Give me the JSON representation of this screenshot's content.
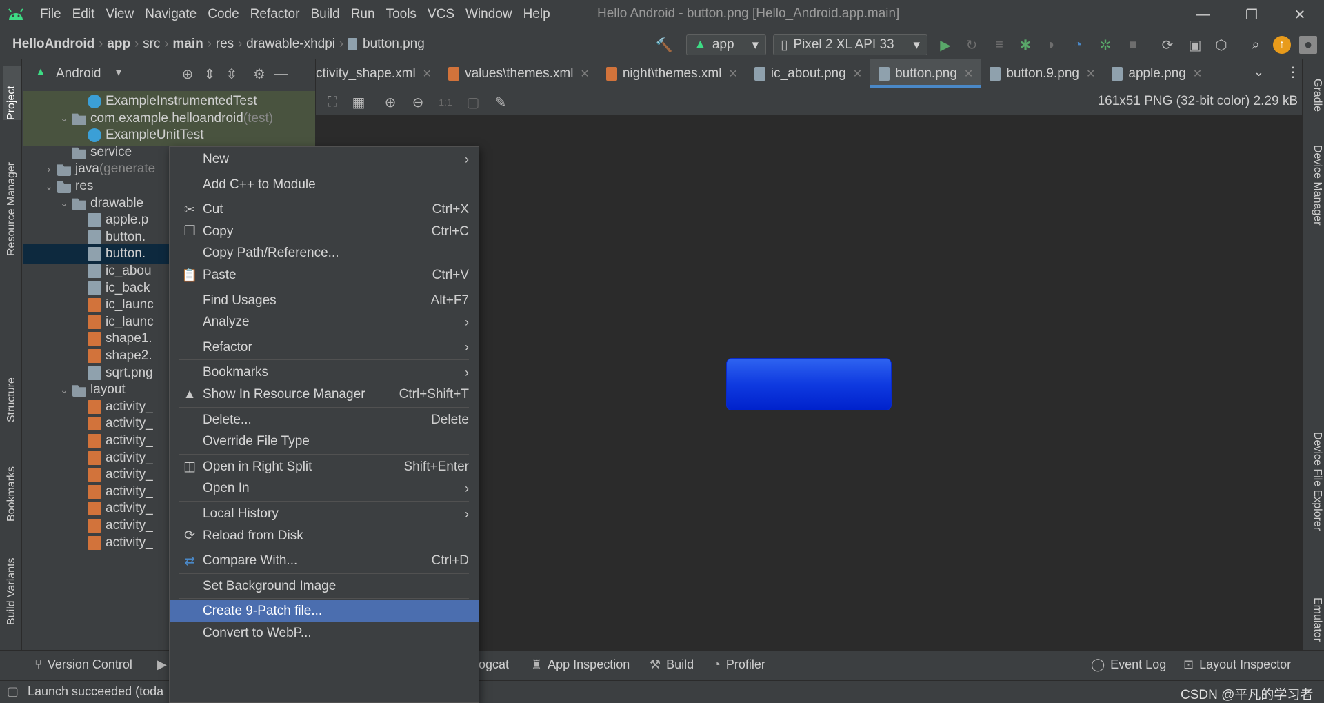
{
  "menubar": {
    "items": [
      "File",
      "Edit",
      "View",
      "Navigate",
      "Code",
      "Refactor",
      "Build",
      "Run",
      "Tools",
      "VCS",
      "Window",
      "Help"
    ],
    "window_title": "Hello Android - button.png [Hello_Android.app.main]"
  },
  "breadcrumb": [
    "HelloAndroid",
    "app",
    "src",
    "main",
    "res",
    "drawable-xhdpi",
    "button.png"
  ],
  "toolbar": {
    "run_config": "app",
    "device": "Pixel 2 XL API 33"
  },
  "project_panel": {
    "view_mode": "Android",
    "tree": [
      {
        "label": "ExampleInstrumentedTest",
        "suffix": "",
        "icon": "class-icon",
        "indent": 3,
        "arrow": "",
        "state": "green"
      },
      {
        "label": "com.example.helloandroid",
        "suffix": " (test)",
        "icon": "folder-icon",
        "indent": 2,
        "arrow": "⌄",
        "state": "green"
      },
      {
        "label": "ExampleUnitTest",
        "suffix": "",
        "icon": "class-icon",
        "indent": 3,
        "arrow": "",
        "state": "green"
      },
      {
        "label": "service",
        "suffix": "",
        "icon": "folder-icon",
        "indent": 2,
        "arrow": "",
        "state": ""
      },
      {
        "label": "java",
        "suffix": " (generate",
        "icon": "folder-icon",
        "indent": 1,
        "arrow": "›",
        "state": ""
      },
      {
        "label": "res",
        "suffix": "",
        "icon": "folder-icon",
        "indent": 1,
        "arrow": "⌄",
        "state": ""
      },
      {
        "label": "drawable",
        "suffix": "",
        "icon": "folder-icon",
        "indent": 2,
        "arrow": "⌄",
        "state": ""
      },
      {
        "label": "apple.p",
        "suffix": "",
        "icon": "png-icon",
        "indent": 3,
        "arrow": "",
        "state": ""
      },
      {
        "label": "button.",
        "suffix": "",
        "icon": "png-icon",
        "indent": 3,
        "arrow": "",
        "state": ""
      },
      {
        "label": "button.",
        "suffix": "",
        "icon": "png-icon",
        "indent": 3,
        "arrow": "",
        "state": "selected"
      },
      {
        "label": "ic_abou",
        "suffix": "",
        "icon": "png-icon",
        "indent": 3,
        "arrow": "",
        "state": ""
      },
      {
        "label": "ic_back",
        "suffix": "",
        "icon": "png-icon",
        "indent": 3,
        "arrow": "",
        "state": ""
      },
      {
        "label": "ic_launc",
        "suffix": "",
        "icon": "xml-icon",
        "indent": 3,
        "arrow": "",
        "state": ""
      },
      {
        "label": "ic_launc",
        "suffix": "",
        "icon": "xml-icon",
        "indent": 3,
        "arrow": "",
        "state": ""
      },
      {
        "label": "shape1.",
        "suffix": "",
        "icon": "xml-icon",
        "indent": 3,
        "arrow": "",
        "state": ""
      },
      {
        "label": "shape2.",
        "suffix": "",
        "icon": "xml-icon",
        "indent": 3,
        "arrow": "",
        "state": ""
      },
      {
        "label": "sqrt.png",
        "suffix": "",
        "icon": "png-icon",
        "indent": 3,
        "arrow": "",
        "state": ""
      },
      {
        "label": "layout",
        "suffix": "",
        "icon": "folder-icon",
        "indent": 2,
        "arrow": "⌄",
        "state": ""
      },
      {
        "label": "activity_",
        "suffix": "",
        "icon": "xml-icon",
        "indent": 3,
        "arrow": "",
        "state": ""
      },
      {
        "label": "activity_",
        "suffix": "",
        "icon": "xml-icon",
        "indent": 3,
        "arrow": "",
        "state": ""
      },
      {
        "label": "activity_",
        "suffix": "",
        "icon": "xml-icon",
        "indent": 3,
        "arrow": "",
        "state": ""
      },
      {
        "label": "activity_",
        "suffix": "",
        "icon": "xml-icon",
        "indent": 3,
        "arrow": "",
        "state": ""
      },
      {
        "label": "activity_",
        "suffix": "",
        "icon": "xml-icon",
        "indent": 3,
        "arrow": "",
        "state": ""
      },
      {
        "label": "activity_",
        "suffix": "",
        "icon": "xml-icon",
        "indent": 3,
        "arrow": "",
        "state": ""
      },
      {
        "label": "activity_",
        "suffix": "",
        "icon": "xml-icon",
        "indent": 3,
        "arrow": "",
        "state": ""
      },
      {
        "label": "activity_",
        "suffix": "",
        "icon": "xml-icon",
        "indent": 3,
        "arrow": "",
        "state": ""
      },
      {
        "label": "activity_",
        "suffix": "",
        "icon": "xml-icon",
        "indent": 3,
        "arrow": "",
        "state": ""
      }
    ]
  },
  "left_tool_tabs": [
    "Project",
    "Resource Manager",
    "Structure",
    "Bookmarks",
    "Build Variants"
  ],
  "right_tool_tabs": [
    "Gradle",
    "Device Manager",
    "Device File Explorer",
    "Emulator"
  ],
  "editor_tabs": [
    {
      "label": "ctivity_shape.xml",
      "type": "xml",
      "active": false
    },
    {
      "label": "values\\themes.xml",
      "type": "xml",
      "active": false
    },
    {
      "label": "night\\themes.xml",
      "type": "xml",
      "active": false
    },
    {
      "label": "ic_about.png",
      "type": "png",
      "active": false
    },
    {
      "label": "button.png",
      "type": "png",
      "active": true
    },
    {
      "label": "button.9.png",
      "type": "png",
      "active": false
    },
    {
      "label": "apple.png",
      "type": "png",
      "active": false
    }
  ],
  "image_viewer": {
    "info": "161x51 PNG (32-bit color) 2.29 kB",
    "zoom_actual_label": "1:1"
  },
  "context_menu": {
    "items": [
      {
        "label": "New",
        "shortcut": "",
        "submenu": true,
        "icon": "",
        "sep_after": true,
        "highlight": false
      },
      {
        "label": "Add C++ to Module",
        "shortcut": "",
        "submenu": false,
        "icon": "",
        "sep_after": true,
        "highlight": false
      },
      {
        "label": "Cut",
        "shortcut": "Ctrl+X",
        "submenu": false,
        "icon": "scissors-icon",
        "sep_after": false,
        "highlight": false
      },
      {
        "label": "Copy",
        "shortcut": "Ctrl+C",
        "submenu": false,
        "icon": "copy-icon",
        "sep_after": false,
        "highlight": false
      },
      {
        "label": "Copy Path/Reference...",
        "shortcut": "",
        "submenu": false,
        "icon": "",
        "sep_after": false,
        "highlight": false
      },
      {
        "label": "Paste",
        "shortcut": "Ctrl+V",
        "submenu": false,
        "icon": "paste-icon",
        "sep_after": true,
        "highlight": false
      },
      {
        "label": "Find Usages",
        "shortcut": "Alt+F7",
        "submenu": false,
        "icon": "",
        "sep_after": false,
        "highlight": false
      },
      {
        "label": "Analyze",
        "shortcut": "",
        "submenu": true,
        "icon": "",
        "sep_after": true,
        "highlight": false
      },
      {
        "label": "Refactor",
        "shortcut": "",
        "submenu": true,
        "icon": "",
        "sep_after": true,
        "highlight": false
      },
      {
        "label": "Bookmarks",
        "shortcut": "",
        "submenu": true,
        "icon": "",
        "sep_after": false,
        "highlight": false
      },
      {
        "label": "Show In Resource Manager",
        "shortcut": "Ctrl+Shift+T",
        "submenu": false,
        "icon": "resource-manager-icon",
        "sep_after": true,
        "highlight": false
      },
      {
        "label": "Delete...",
        "shortcut": "Delete",
        "submenu": false,
        "icon": "",
        "sep_after": false,
        "highlight": false
      },
      {
        "label": "Override File Type",
        "shortcut": "",
        "submenu": false,
        "icon": "",
        "sep_after": true,
        "highlight": false
      },
      {
        "label": "Open in Right Split",
        "shortcut": "Shift+Enter",
        "submenu": false,
        "icon": "split-icon",
        "sep_after": false,
        "highlight": false
      },
      {
        "label": "Open In",
        "shortcut": "",
        "submenu": true,
        "icon": "",
        "sep_after": true,
        "highlight": false
      },
      {
        "label": "Local History",
        "shortcut": "",
        "submenu": true,
        "icon": "",
        "sep_after": false,
        "highlight": false
      },
      {
        "label": "Reload from Disk",
        "shortcut": "",
        "submenu": false,
        "icon": "reload-icon",
        "sep_after": true,
        "highlight": false
      },
      {
        "label": "Compare With...",
        "shortcut": "Ctrl+D",
        "submenu": false,
        "icon": "compare-icon",
        "sep_after": true,
        "highlight": false
      },
      {
        "label": "Set Background Image",
        "shortcut": "",
        "submenu": false,
        "icon": "",
        "sep_after": true,
        "highlight": false
      },
      {
        "label": "Create 9-Patch file...",
        "shortcut": "",
        "submenu": false,
        "icon": "",
        "sep_after": false,
        "highlight": true
      },
      {
        "label": "Convert to WebP...",
        "shortcut": "",
        "submenu": false,
        "icon": "",
        "sep_after": false,
        "highlight": false
      }
    ]
  },
  "bottom_bar": {
    "version_control": "Version Control",
    "logcat": "ogcat",
    "app_inspection": "App Inspection",
    "build": "Build",
    "profiler": "Profiler",
    "event_log": "Event Log",
    "layout_inspector": "Layout Inspector"
  },
  "status_bar": {
    "message": "Launch succeeded (toda",
    "watermark": "CSDN @平凡的学习者"
  },
  "colors": {
    "accent": "#4a88c7",
    "menu_highlight": "#4b6eaf",
    "run_green": "#59a869",
    "preview_blue": "#0f3ae0"
  }
}
